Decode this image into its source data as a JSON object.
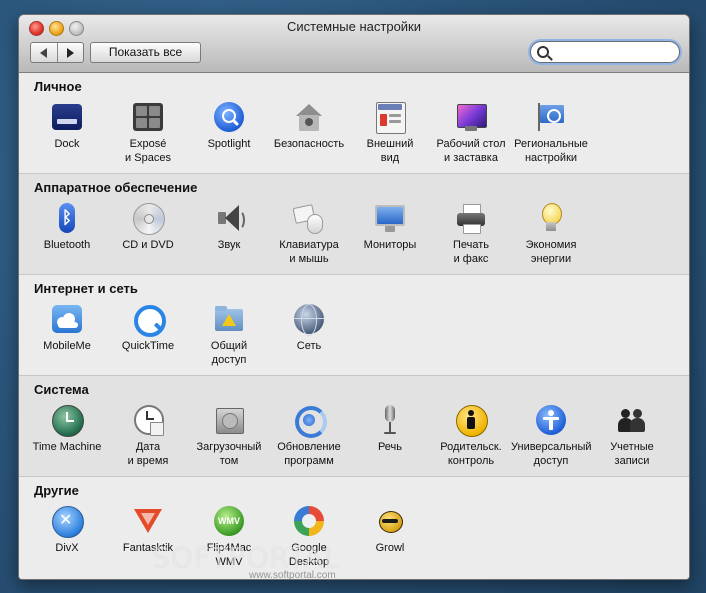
{
  "window": {
    "title": "Системные настройки"
  },
  "toolbar": {
    "show_all": "Показать все",
    "search_placeholder": ""
  },
  "sections": [
    {
      "title": "Личное",
      "items": [
        {
          "label": "Dock",
          "icon": "dock-icon"
        },
        {
          "label": "Exposé\nи Spaces",
          "icon": "expose-icon"
        },
        {
          "label": "Spotlight",
          "icon": "spotlight-icon"
        },
        {
          "label": "Безопасность",
          "icon": "security-house-icon"
        },
        {
          "label": "Внешний\nвид",
          "icon": "appearance-icon"
        },
        {
          "label": "Рабочий стол\nи заставка",
          "icon": "desktop-icon"
        },
        {
          "label": "Региональные\nнастройки",
          "icon": "flag-icon"
        }
      ]
    },
    {
      "title": "Аппаратное обеспечение",
      "items": [
        {
          "label": "Bluetooth",
          "icon": "bluetooth-icon"
        },
        {
          "label": "CD и DVD",
          "icon": "cd-icon"
        },
        {
          "label": "Звук",
          "icon": "speaker-icon"
        },
        {
          "label": "Клавиатура\nи мышь",
          "icon": "keyboard-mouse-icon"
        },
        {
          "label": "Мониторы",
          "icon": "monitor-icon"
        },
        {
          "label": "Печать\nи факс",
          "icon": "printer-icon"
        },
        {
          "label": "Экономия\nэнергии",
          "icon": "lightbulb-icon"
        }
      ]
    },
    {
      "title": "Интернет и сеть",
      "items": [
        {
          "label": "MobileMe",
          "icon": "cloud-icon"
        },
        {
          "label": "QuickTime",
          "icon": "quicktime-icon"
        },
        {
          "label": "Общий\nдоступ",
          "icon": "sharing-folder-icon"
        },
        {
          "label": "Сеть",
          "icon": "network-globe-icon"
        }
      ]
    },
    {
      "title": "Система",
      "items": [
        {
          "label": "Time Machine",
          "icon": "time-machine-icon"
        },
        {
          "label": "Дата\nи время",
          "icon": "clock-icon"
        },
        {
          "label": "Загрузочный\nтом",
          "icon": "hard-drive-icon"
        },
        {
          "label": "Обновление\nпрограмм",
          "icon": "update-icon"
        },
        {
          "label": "Речь",
          "icon": "microphone-icon"
        },
        {
          "label": "Родительск.\nконтроль",
          "icon": "parental-control-icon"
        },
        {
          "label": "Универсальный\nдоступ",
          "icon": "accessibility-icon"
        },
        {
          "label": "Учетные\nзаписи",
          "icon": "accounts-icon"
        }
      ]
    },
    {
      "title": "Другие",
      "items": [
        {
          "label": "DivX",
          "icon": "divx-icon"
        },
        {
          "label": "Fantasktik",
          "icon": "fantasktik-icon"
        },
        {
          "label": "Flip4Mac\nWMV",
          "icon": "flip4mac-icon"
        },
        {
          "label": "Google\nDesktop",
          "icon": "google-desktop-icon"
        },
        {
          "label": "Growl",
          "icon": "growl-icon"
        }
      ]
    }
  ],
  "watermark": {
    "text": "SOFTPORTAL",
    "sub": "www.softportal.com"
  }
}
